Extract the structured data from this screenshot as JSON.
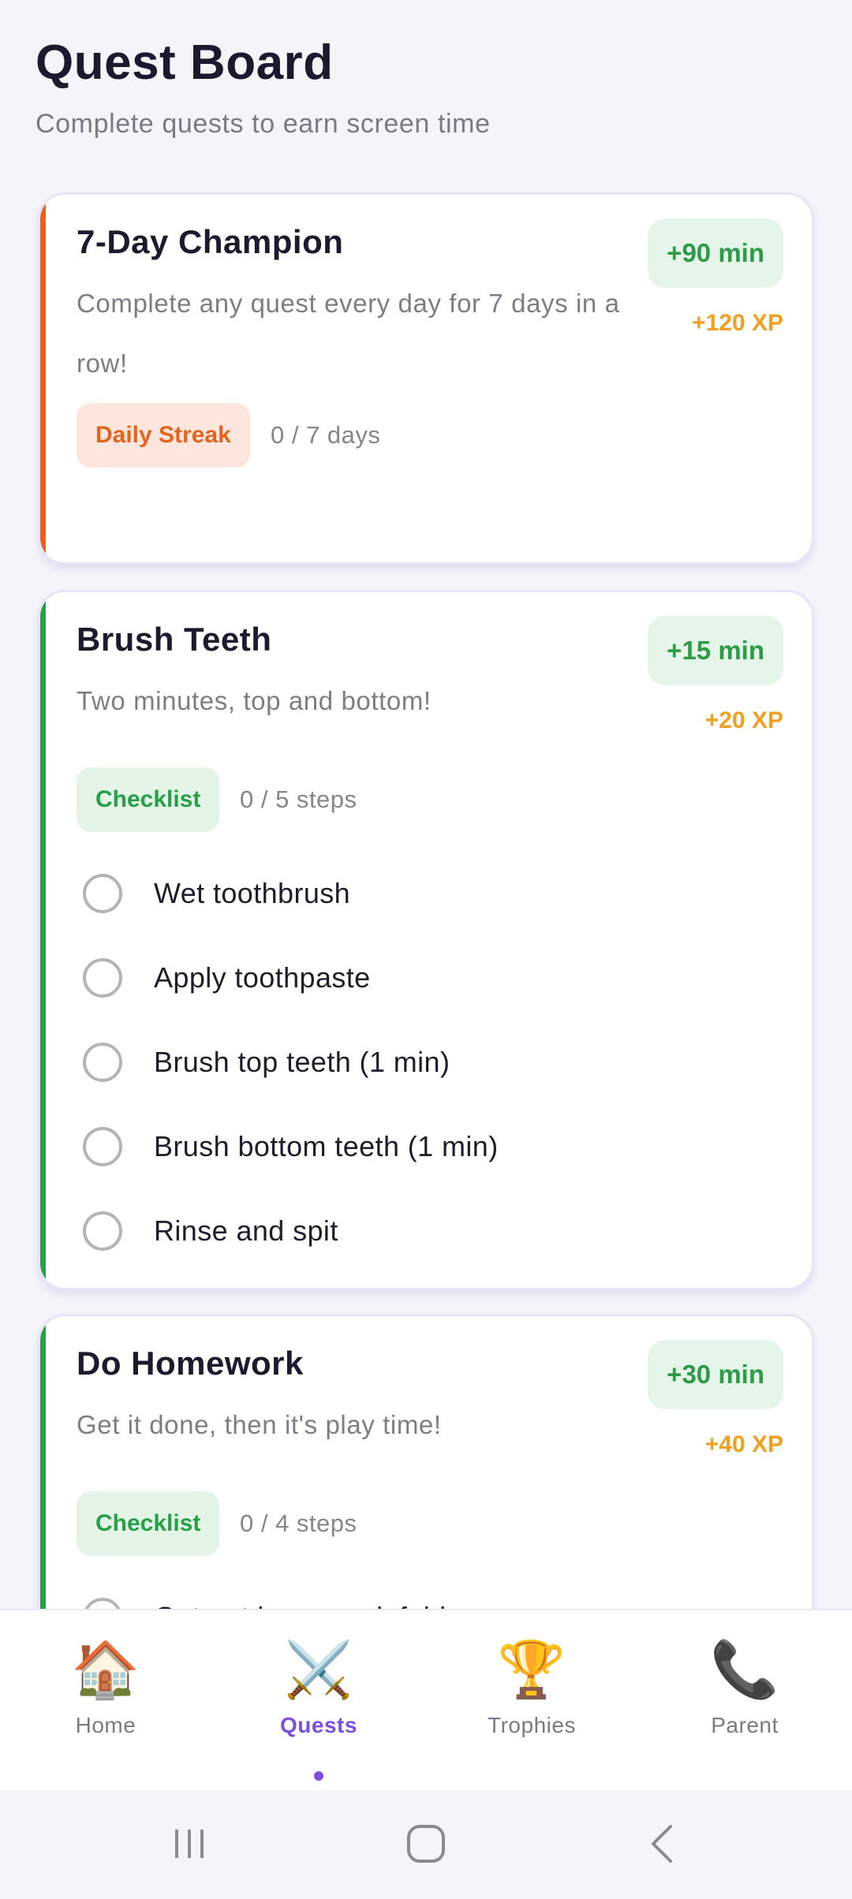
{
  "header": {
    "title": "Quest Board",
    "subtitle": "Complete quests to earn screen time"
  },
  "quests": [
    {
      "title": "7-Day Champion",
      "description": "Complete any quest every day for 7 days in a row!",
      "reward": "+90 min",
      "xp": "+120 XP",
      "tag": "Daily Streak",
      "progress": "0 / 7 days",
      "accent": "#e3641e"
    },
    {
      "title": "Brush Teeth",
      "description": "Two minutes, top and bottom!",
      "reward": "+15 min",
      "xp": "+20 XP",
      "tag": "Checklist",
      "progress": "0 / 5 steps",
      "accent": "#27a04a",
      "steps": [
        "Wet toothbrush",
        "Apply toothpaste",
        "Brush top teeth (1 min)",
        "Brush bottom teeth (1 min)",
        "Rinse and spit"
      ]
    },
    {
      "title": "Do Homework",
      "description": "Get it done, then it's play time!",
      "reward": "+30 min",
      "xp": "+40 XP",
      "tag": "Checklist",
      "progress": "0 / 4 steps",
      "accent": "#27a04a",
      "steps": [
        "Get out homework folder"
      ]
    }
  ],
  "nav": {
    "items": [
      {
        "label": "Home",
        "icon": "🏠",
        "icon_name": "house-icon"
      },
      {
        "label": "Quests",
        "icon": "⚔️",
        "icon_name": "crossed-swords-icon"
      },
      {
        "label": "Trophies",
        "icon": "🏆",
        "icon_name": "trophy-icon"
      },
      {
        "label": "Parent",
        "icon": "📞",
        "icon_name": "phone-icon"
      }
    ],
    "active": "Quests"
  },
  "system_nav": {
    "buttons": [
      "recent-apps-icon",
      "home-icon",
      "back-icon"
    ]
  },
  "colors": {
    "accent": "#7b4fe0",
    "reward_text": "#2f9a48",
    "xp_text": "#f0a020"
  }
}
